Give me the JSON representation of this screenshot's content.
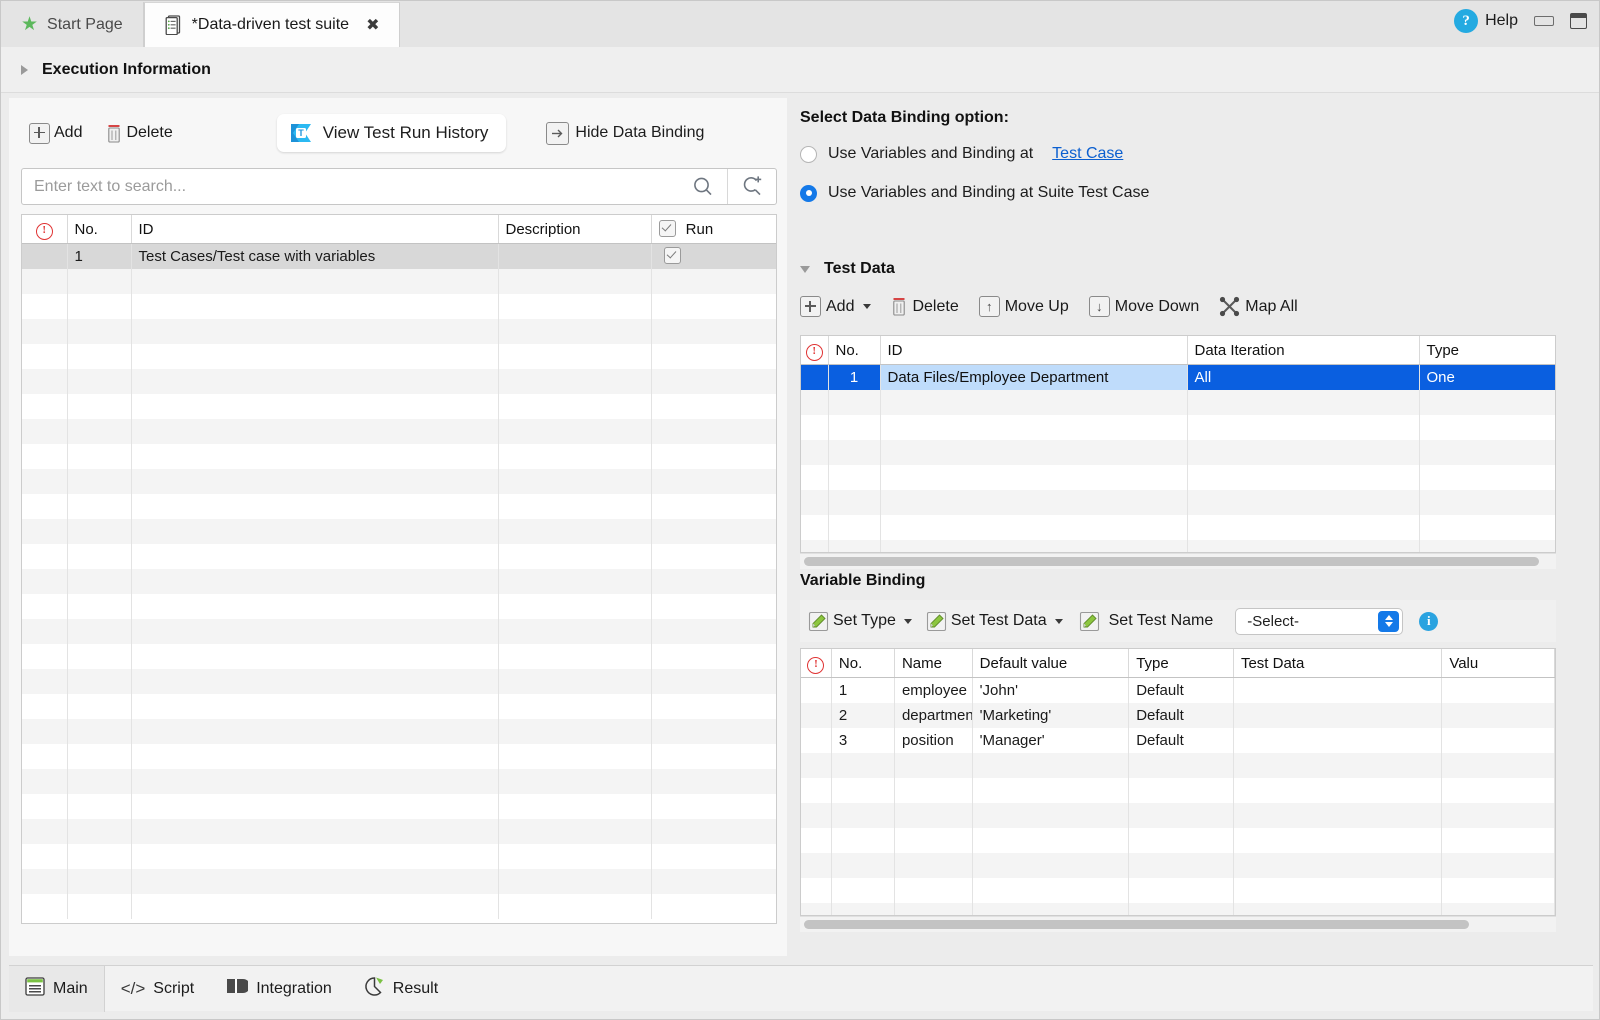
{
  "window": {
    "tabs": [
      {
        "label": "Start Page",
        "icon": "star-icon",
        "active": false
      },
      {
        "label": "*Data-driven test suite",
        "icon": "test-suite-icon",
        "active": true,
        "closable": true
      }
    ],
    "help_label": "Help",
    "help_icon": "question-mark-icon",
    "minimize_icon": "minimize-icon",
    "maximize_icon": "maximize-icon"
  },
  "execution": {
    "title": "Execution Information",
    "collapsed": true
  },
  "left": {
    "toolbar": {
      "add_label": "Add",
      "delete_label": "Delete",
      "history_label": "View Test Run History",
      "hide_binding_label": "Hide Data Binding"
    },
    "search": {
      "placeholder": "Enter text to search...",
      "value": ""
    },
    "table": {
      "columns": [
        "",
        "No.",
        "ID",
        "Description",
        "Run"
      ],
      "run_header_checked": true,
      "rows": [
        {
          "no": "1",
          "id": "Test Cases/Test case with variables",
          "description": "",
          "run": true
        }
      ],
      "empty_rows": 26
    }
  },
  "right": {
    "binding_option": {
      "title": "Select Data Binding option:",
      "options": [
        {
          "label": "Use Variables and Binding at",
          "link": "Test Case",
          "selected": false
        },
        {
          "label": "Use Variables and Binding at Suite Test Case",
          "link": "",
          "selected": true
        }
      ]
    },
    "test_data": {
      "title": "Test Data",
      "expanded": true,
      "toolbar": {
        "add_label": "Add",
        "delete_label": "Delete",
        "move_up_label": "Move Up",
        "move_down_label": "Move Down",
        "map_all_label": "Map All"
      },
      "columns": [
        "",
        "No.",
        "ID",
        "Data Iteration",
        "Type"
      ],
      "rows": [
        {
          "no": "1",
          "id": "Data Files/Employee Department",
          "iteration": "All",
          "type": "One",
          "selected": true
        }
      ],
      "empty_rows": 7
    },
    "variable_binding": {
      "title": "Variable Binding",
      "toolbar": {
        "set_type_label": "Set Type",
        "set_test_data_label": "Set Test Data",
        "set_test_name_label": "Set Test Name",
        "select_value": "-Select-",
        "info_icon": "info-icon"
      },
      "columns": [
        "",
        "No.",
        "Name",
        "Default value",
        "Type",
        "Test Data",
        "Valu"
      ],
      "rows": [
        {
          "no": "1",
          "name": "employee",
          "default": "'John'",
          "type": "Default",
          "test_data": "",
          "value": ""
        },
        {
          "no": "2",
          "name": "department",
          "default": "'Marketing'",
          "type": "Default",
          "test_data": "",
          "value": ""
        },
        {
          "no": "3",
          "name": "position",
          "default": "'Manager'",
          "type": "Default",
          "test_data": "",
          "value": ""
        }
      ],
      "empty_rows": 7
    }
  },
  "bottom_tabs": [
    {
      "label": "Main",
      "icon": "main-icon",
      "active": true
    },
    {
      "label": "Script",
      "icon": "code-icon",
      "active": false
    },
    {
      "label": "Integration",
      "icon": "integration-icon",
      "active": false
    },
    {
      "label": "Result",
      "icon": "pie-chart-icon",
      "active": false
    }
  ],
  "colors": {
    "accent": "#0a5fe0",
    "link": "#0b5fd0",
    "selection_light": "#bfdcfb",
    "error": "#e03434"
  }
}
